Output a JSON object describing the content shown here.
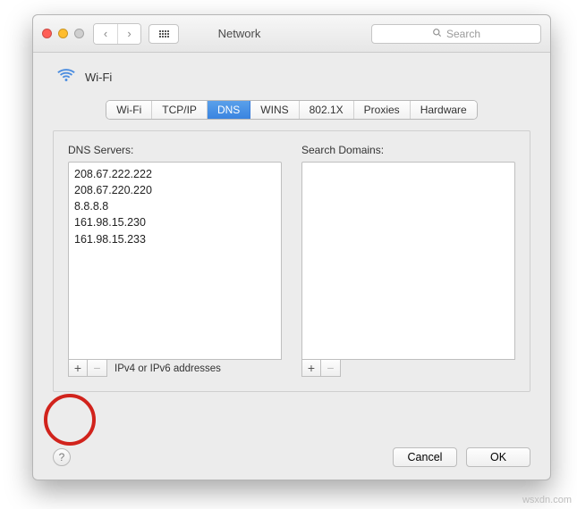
{
  "titlebar": {
    "title": "Network",
    "search_placeholder": "Search"
  },
  "connection": {
    "name": "Wi-Fi"
  },
  "tabs": [
    {
      "label": "Wi-Fi"
    },
    {
      "label": "TCP/IP"
    },
    {
      "label": "DNS",
      "active": true
    },
    {
      "label": "WINS"
    },
    {
      "label": "802.1X"
    },
    {
      "label": "Proxies"
    },
    {
      "label": "Hardware"
    }
  ],
  "dns": {
    "servers_header": "DNS Servers:",
    "domains_header": "Search Domains:",
    "servers": [
      "208.67.222.222",
      "208.67.220.220",
      "8.8.8.8",
      "161.98.15.230",
      "161.98.15.233"
    ],
    "domains": [],
    "hint": "IPv4 or IPv6 addresses",
    "plus": "+",
    "minus": "−"
  },
  "buttons": {
    "help": "?",
    "cancel": "Cancel",
    "ok": "OK"
  },
  "watermark": "wsxdn.com"
}
